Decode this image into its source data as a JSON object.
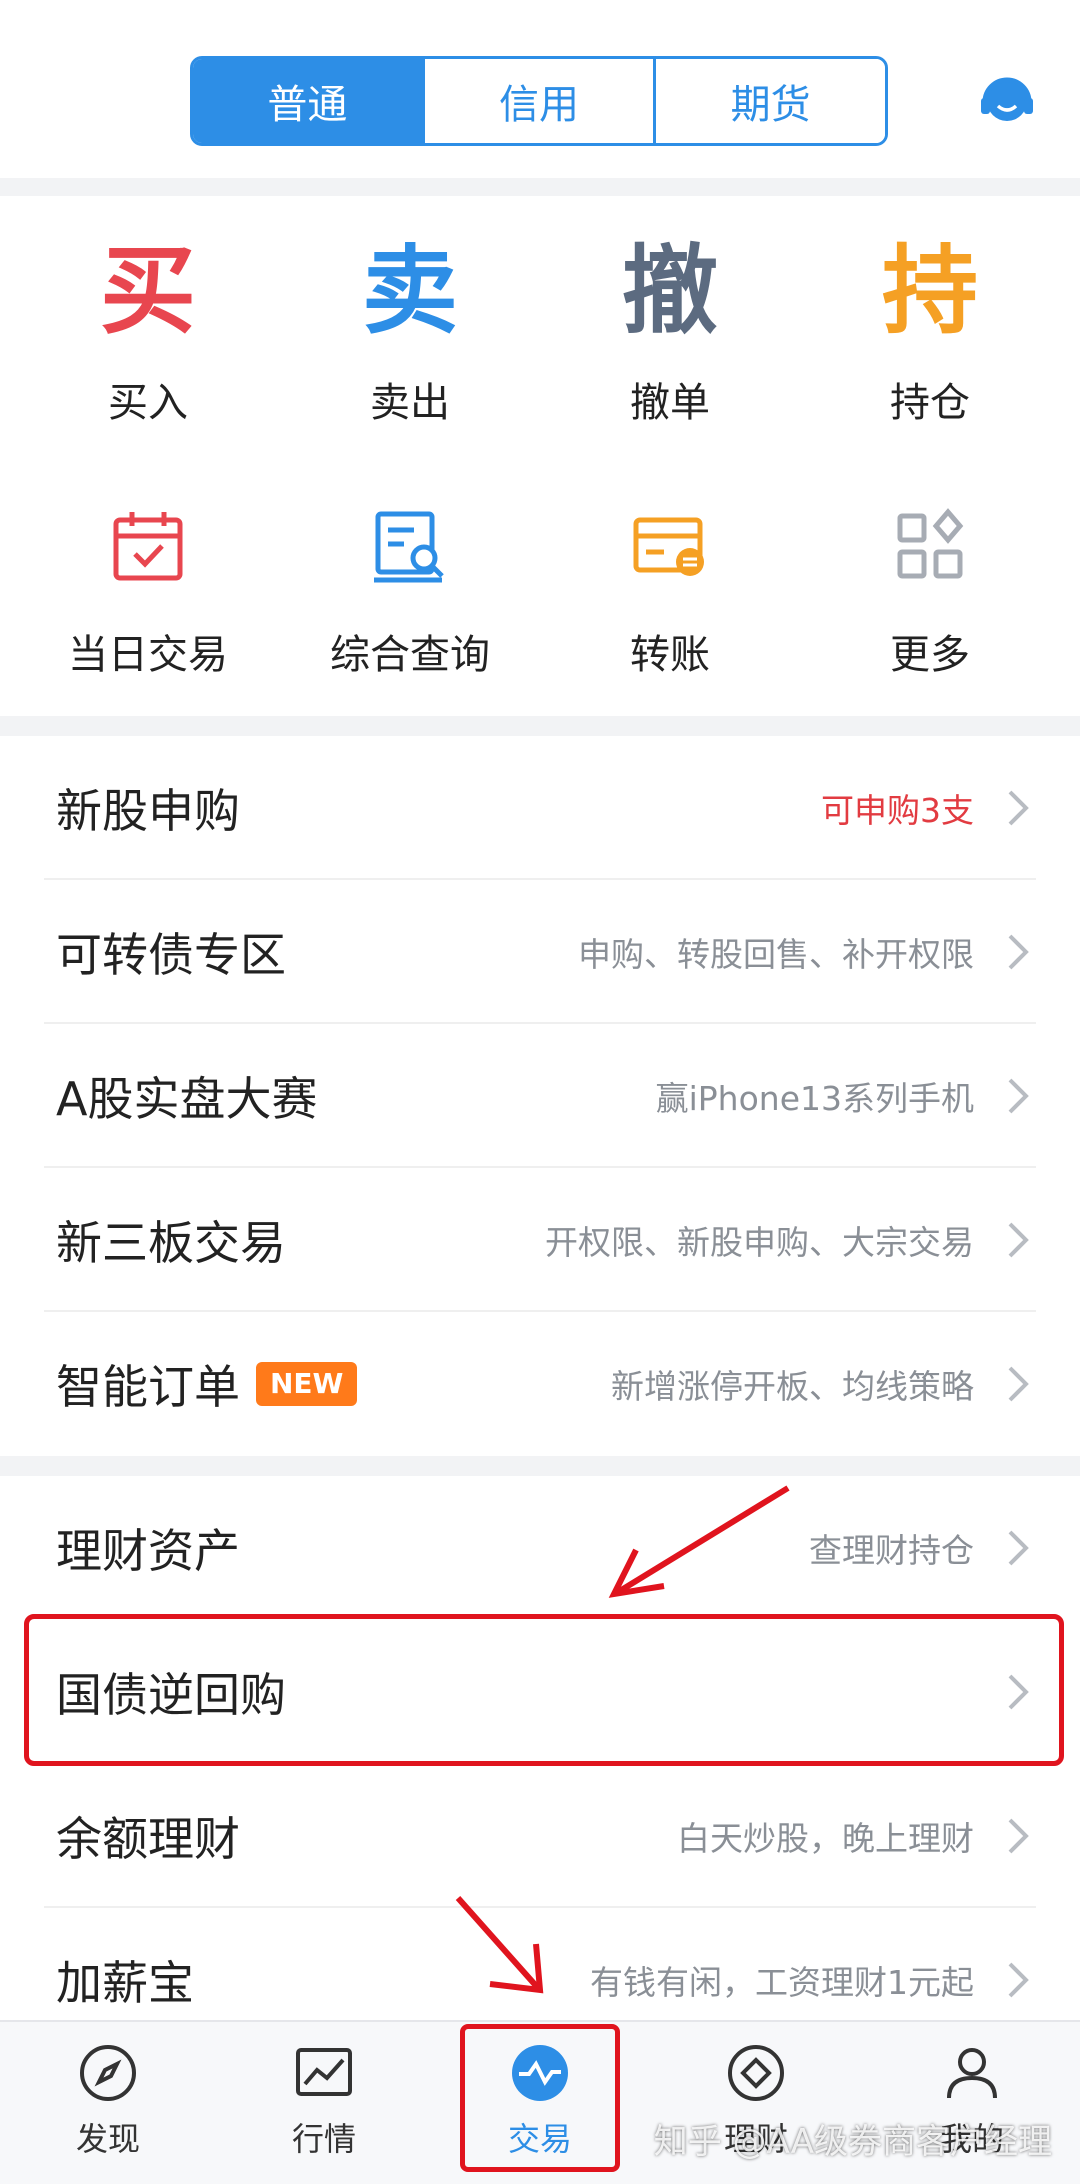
{
  "header": {
    "segments": [
      "普通",
      "信用",
      "期货"
    ],
    "support_icon": "headset-icon"
  },
  "quick_actions": {
    "row1": [
      {
        "char": "买",
        "label": "买入",
        "color": "#e8464f"
      },
      {
        "char": "卖",
        "label": "卖出",
        "color": "#2d8ee6"
      },
      {
        "char": "撤",
        "label": "撤单",
        "color": "#5c6b80"
      },
      {
        "char": "持",
        "label": "持仓",
        "color": "#f5a024"
      }
    ],
    "row2": [
      {
        "label": "当日交易",
        "icon": "calendar-check-icon",
        "color": "#e8464f"
      },
      {
        "label": "综合查询",
        "icon": "search-document-icon",
        "color": "#2d8ee6"
      },
      {
        "label": "转账",
        "icon": "card-transfer-icon",
        "color": "#f5a024"
      },
      {
        "label": "更多",
        "icon": "grid-more-icon",
        "color": "#a7acb4"
      }
    ]
  },
  "list1": [
    {
      "title": "新股申购",
      "sub": "可申购3支"
    },
    {
      "title": "可转债专区",
      "sub": "申购、转股回售、补开权限"
    },
    {
      "title": "A股实盘大赛",
      "sub": "赢iPhone13系列手机"
    },
    {
      "title": "新三板交易",
      "sub": "开权限、新股申购、大宗交易"
    },
    {
      "title": "智能订单",
      "badge": "NEW",
      "sub": "新增涨停开板、均线策略"
    }
  ],
  "list2": [
    {
      "title": "理财资产",
      "sub": "查理财持仓"
    },
    {
      "title": "国债逆回购",
      "sub": ""
    },
    {
      "title": "余额理财",
      "sub": "白天炒股，晚上理财"
    },
    {
      "title": "加薪宝",
      "sub": "有钱有闲，工资理财1元起"
    }
  ],
  "tabbar": [
    {
      "label": "发现",
      "icon": "compass-icon"
    },
    {
      "label": "行情",
      "icon": "chart-icon"
    },
    {
      "label": "交易",
      "icon": "trade-wave-icon",
      "active": true
    },
    {
      "label": "理财",
      "icon": "diamond-icon"
    },
    {
      "label": "我的",
      "icon": "user-icon"
    }
  ],
  "watermark": "知乎 @AA级券商客户经理",
  "colors": {
    "accent": "#2d8ee6",
    "annotation_red": "#e0141e"
  }
}
